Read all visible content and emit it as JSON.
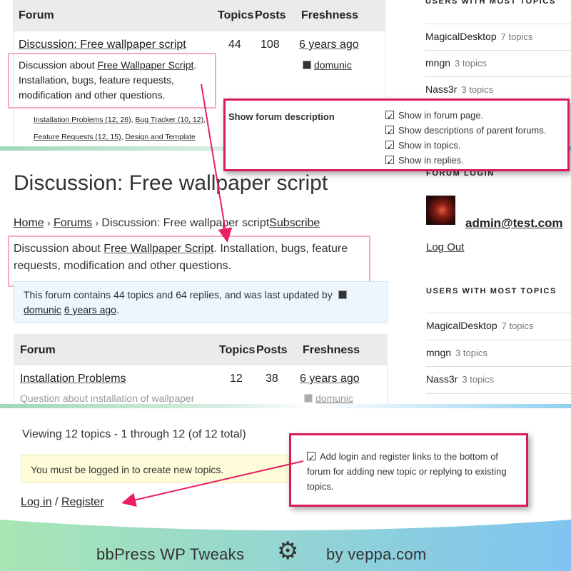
{
  "top": {
    "headers": {
      "forum": "Forum",
      "topics": "Topics",
      "posts": "Posts",
      "freshness": "Freshness"
    },
    "row": {
      "title": "Discussion: Free wallpaper script",
      "topics": "44",
      "posts": "108",
      "freshness": "6 years ago",
      "author": "domunic",
      "desc_prefix": "Discussion about ",
      "desc_link": "Free Wallpaper Script",
      "desc_suffix": ". Installation, bugs, feature requests, modification and other questions.",
      "sub1": "Installation Problems (12, 26)",
      "sub2": "Bug Tracker (10, 12)",
      "sub3": "Feature Requests (12, 15)",
      "sub4": "Design and Template"
    },
    "sidebar_heading": "USERS WITH MOST TOPICS",
    "sidebar_users": [
      {
        "name": "MagicalDesktop",
        "count": "7 topics"
      },
      {
        "name": "mngn",
        "count": "3 topics"
      },
      {
        "name": "Nass3r",
        "count": "3 topics"
      }
    ]
  },
  "callout1": {
    "label": "Show forum description",
    "options": [
      "Show in forum page.",
      "Show descriptions of parent forums.",
      "Show in topics.",
      "Show in replies."
    ]
  },
  "middle": {
    "title": "Discussion: Free wallpaper script",
    "breadcrumb": {
      "home": "Home",
      "sep": "›",
      "forums": "Forums",
      "current": "Discussion: Free wallpaper script",
      "subscribe": "Subscribe"
    },
    "desc_prefix": "Discussion about ",
    "desc_link": "Free Wallpaper Script",
    "desc_suffix": ". Installation, bugs, feature requests, modification and other questions.",
    "notice_text": "This forum contains 44 topics and 64 replies, and was last updated by",
    "notice_author": "domunic",
    "notice_time": "6 years ago",
    "headers": {
      "forum": "Forum",
      "topics": "Topics",
      "posts": "Posts",
      "freshness": "Freshness"
    },
    "row": {
      "title": "Installation Problems",
      "topics": "12",
      "posts": "38",
      "freshness": "6 years ago",
      "desc": "Question about installation of wallpaper",
      "author": "domunic"
    },
    "forum_login_heading": "FORUM LOGIN",
    "login_user": "admin@test.com",
    "logout": "Log Out",
    "sidebar_heading": "USERS WITH MOST TOPICS",
    "sidebar_users": [
      {
        "name": "MagicalDesktop",
        "count": "7 topics"
      },
      {
        "name": "mngn",
        "count": "3 topics"
      },
      {
        "name": "Nass3r",
        "count": "3 topics"
      }
    ]
  },
  "bottom": {
    "viewing": "Viewing 12 topics - 1 through 12 (of 12 total)",
    "must_login": "You must be logged in to create new topics.",
    "login": "Log in",
    "slash": "/",
    "register": "Register"
  },
  "callout2": {
    "text": "Add login and register links to the bottom of forum for adding new topic or replying to existing topics."
  },
  "footer": {
    "product": "bbPress WP Tweaks",
    "by": "by veppa.com"
  },
  "colors": {
    "callout_border": "#d81b60",
    "highlight_border": "#f5a9c6",
    "notice_bg": "#eef6fd",
    "warning_bg": "#fefcd9",
    "footer_gradient_left": "#a8e6b4",
    "footer_gradient_right": "#7fc4f0"
  },
  "icons": [
    "gear-icon",
    "avatar-icon",
    "checkbox-icon",
    "arrow-icon"
  ]
}
